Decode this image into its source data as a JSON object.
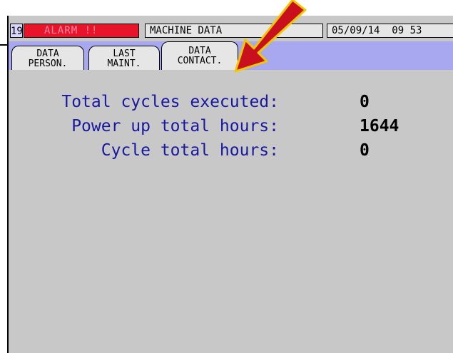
{
  "status_bar": {
    "alarm_number": "19",
    "alarm_text": "ALARM !!",
    "screen_title": "MACHINE DATA",
    "datetime": "05/09/14  09 53"
  },
  "tabs": [
    {
      "line1": "DATA",
      "line2": "PERSON.",
      "active": false
    },
    {
      "line1": "LAST",
      "line2": "MAINT.",
      "active": false
    },
    {
      "line1": "DATA",
      "line2": "CONTACT.",
      "active": true
    }
  ],
  "machine_data": [
    {
      "label": "Total cycles executed:",
      "value": "0"
    },
    {
      "label": "Power up total hours:",
      "value": "1644"
    },
    {
      "label": "Cycle total hours:",
      "value": "0"
    }
  ],
  "colors": {
    "alarm_bg": "#e8142a",
    "tab_strip_bg": "#a8a8f0",
    "label_text": "#1818a0",
    "arrow_fill": "#c8101e",
    "arrow_outline": "#f0c800"
  }
}
